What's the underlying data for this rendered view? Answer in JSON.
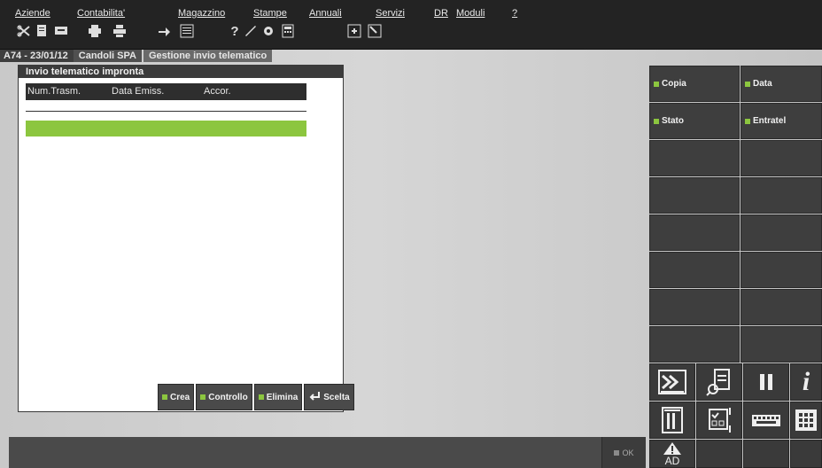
{
  "menubar": {
    "items": [
      "Aziende",
      "Contabilita'",
      "Magazzino",
      "Stampe",
      "Annuali",
      "Servizi",
      "DR",
      "Moduli",
      "?"
    ]
  },
  "toolbar": {
    "icons": [
      "scissors-icon",
      "document-icon",
      "printer-icon",
      "printer-alt-icon",
      "arrow-icon",
      "list-icon",
      "help-icon",
      "tools-icon",
      "config-icon",
      "calculator-icon",
      "expand-icon",
      "window-icon"
    ]
  },
  "breadcrumb": {
    "company": "A74 - 23/01/12",
    "company_name": "Candoli SPA",
    "section": "Gestione invio telematico"
  },
  "panel": {
    "title": "Invio telematico impronta",
    "columns": [
      "Num.Trasm.",
      "Data Emiss.",
      "Accor."
    ],
    "buttons": {
      "crea": "Crea",
      "controllo": "Controllo",
      "elimina": "Elimina",
      "scelta": "Scelta"
    }
  },
  "right_panel": {
    "copia": "Copia",
    "data": "Data",
    "stato": "Stato",
    "entratel": "Entratel",
    "ad_label": "AD"
  },
  "statusbar": {
    "ok": "OK"
  },
  "colors": {
    "accent": "#8cc63f",
    "dark": "#3e3e3e"
  }
}
